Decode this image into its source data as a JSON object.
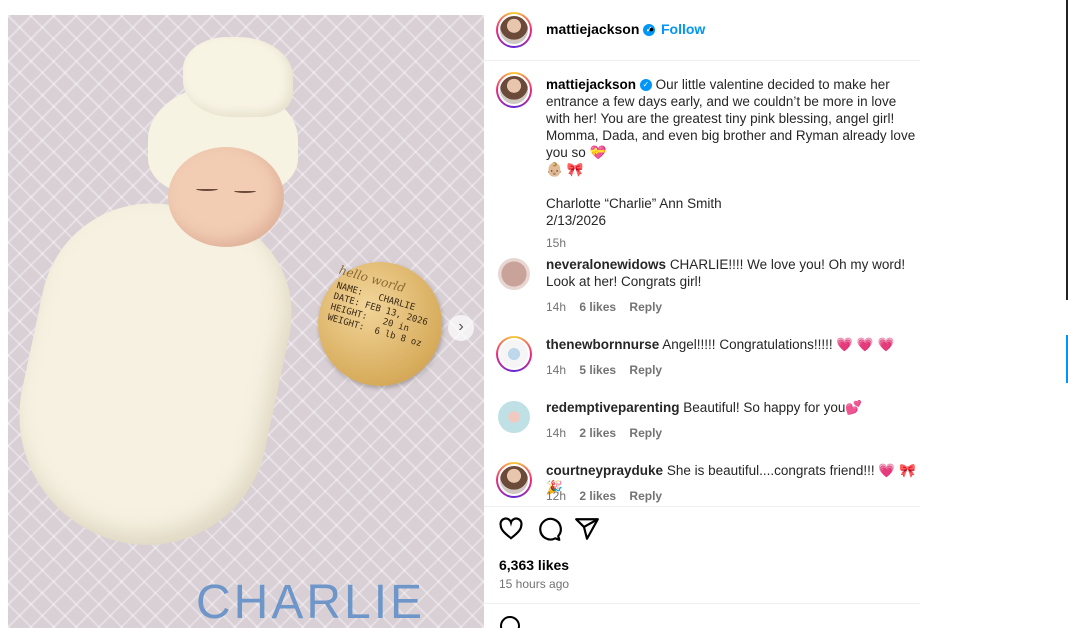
{
  "post": {
    "username": "mattiejackson",
    "follow_label": "Follow",
    "separator": "•"
  },
  "photo": {
    "plaque_script": "hello world",
    "plaque_lines": "NAME:   CHARLIE\nDATE: FEB 13, 2026\nHEIGHT:   20 in\nWEIGHT:  6 lb 8 oz",
    "blanket_name": "CHARLIE"
  },
  "caption": {
    "username": "mattiejackson",
    "text": "Our little valentine decided to make her entrance a few days early, and we couldn’t be more in love with her! You are the greatest tiny pink blessing, angel girl! Momma, Dada, and even big brother and Ryman already love you so 💝",
    "text2": "👶🏼 🎀",
    "name_line": "Charlotte “Charlie” Ann Smith",
    "date_line": "2/13/2026",
    "age": "15h"
  },
  "comments": [
    {
      "user": "neveralonewidows",
      "text": "CHARLIE!!!! We love you! Oh my word! Look at her! Congrats girl!",
      "age": "14h",
      "likes": "6 likes",
      "reply": "Reply"
    },
    {
      "user": "thenewbornnurse",
      "text": "Angel!!!!! Congratulations!!!!! 💗 💗 💗",
      "age": "14h",
      "likes": "5 likes",
      "reply": "Reply"
    },
    {
      "user": "redemptiveparenting",
      "text": "Beautiful! So happy for you💕",
      "age": "14h",
      "likes": "2 likes",
      "reply": "Reply"
    },
    {
      "user": "courtneyprayduke",
      "text": "She is beautiful....congrats friend!!! 💗 🎀 🎉",
      "age": "12h",
      "likes": "2 likes",
      "reply": "Reply"
    }
  ],
  "stats": {
    "likes": "6,363 likes",
    "posted": "15 hours ago"
  },
  "icons": [
    "heart-icon",
    "comment-icon",
    "share-icon",
    "chevron-right-icon",
    "verified-icon"
  ],
  "colors": {
    "accent": "#0095f6",
    "muted": "#737373"
  }
}
